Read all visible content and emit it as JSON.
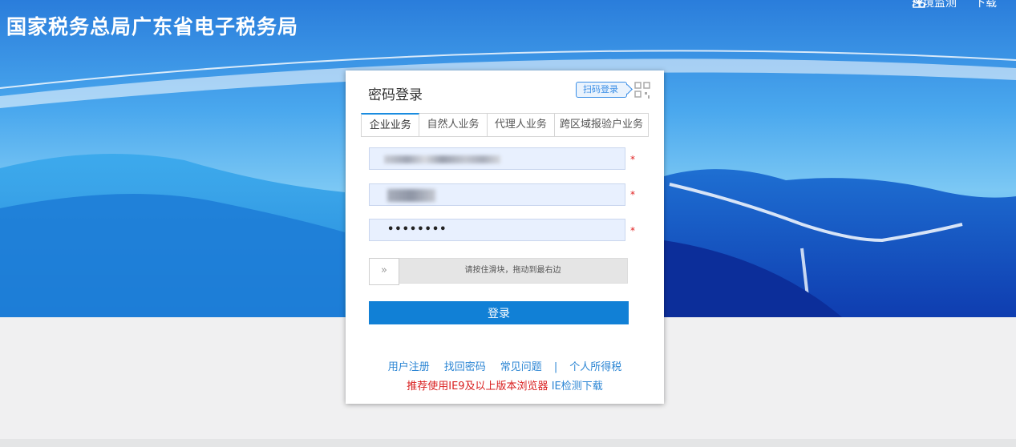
{
  "header": {
    "site_title": "国家税务总局广东省电子税务局",
    "env_check": "环境监测",
    "download": "下载"
  },
  "login_card": {
    "title": "密码登录",
    "qr_login_label": "扫码登录",
    "tabs": [
      {
        "label": "企业业务",
        "active": true
      },
      {
        "label": "自然人业务",
        "active": false
      },
      {
        "label": "代理人业务",
        "active": false
      },
      {
        "label": "跨区域报验户业务",
        "active": false
      }
    ],
    "fields": {
      "account_value": "",
      "user_value": "",
      "password_value": "••••••••",
      "required_mark": "*"
    },
    "slider": {
      "handle_glyph": "»",
      "text": "请按住滑块，拖动到最右边"
    },
    "login_button": "登录",
    "links": {
      "register": "用户注册",
      "forgot_password": "找回密码",
      "faq": "常见问题",
      "separator": "|",
      "personal_tax": "个人所得税"
    },
    "notice": {
      "recommend": "推荐使用IE9及以上版本浏览器",
      "ie_check": "IE检测下载"
    }
  },
  "colors": {
    "accent": "#1180d6",
    "link": "#2c86d4",
    "required": "#e02020"
  }
}
